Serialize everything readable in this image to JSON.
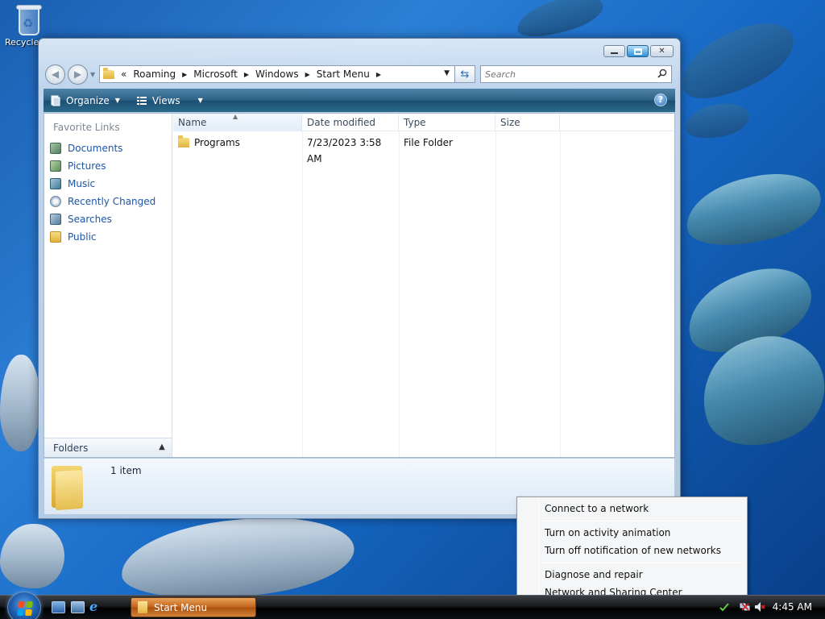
{
  "desktop": {
    "recycle_bin_label": "Recycle Bin"
  },
  "window": {
    "caption_buttons": [
      "minimize-icon",
      "maximize-icon",
      "close-icon"
    ],
    "address": {
      "overflow": "«",
      "crumbs": [
        "Roaming",
        "Microsoft",
        "Windows",
        "Start Menu"
      ]
    },
    "search_placeholder": "Search",
    "toolbar": {
      "organize_label": "Organize",
      "views_label": "Views",
      "help_label": "?"
    },
    "nav_pane": {
      "title": "Favorite Links",
      "links": [
        {
          "label": "Documents",
          "icon": "documents-icon"
        },
        {
          "label": "Pictures",
          "icon": "pictures-icon"
        },
        {
          "label": "Music",
          "icon": "music-icon"
        },
        {
          "label": "Recently Changed",
          "icon": "recently-changed-icon"
        },
        {
          "label": "Searches",
          "icon": "searches-icon"
        },
        {
          "label": "Public",
          "icon": "public-folder-icon"
        }
      ],
      "folders_label": "Folders"
    },
    "columns": [
      "Name",
      "Date modified",
      "Type",
      "Size"
    ],
    "rows": [
      {
        "name": "Programs",
        "date": "7/23/2023 3:58 AM",
        "type": "File Folder",
        "size": ""
      }
    ],
    "details": {
      "item_count": "1 item"
    }
  },
  "context_menu": {
    "items": [
      "Connect to a network",
      "Turn on activity animation",
      "Turn off notification of new networks",
      "Diagnose and repair",
      "Network and Sharing Center"
    ]
  },
  "taskbar": {
    "task_label": "Start Menu",
    "clock": "4:45 AM"
  },
  "colors": {
    "link": "#1d55a8",
    "toolbar": "#2d6287",
    "task_active": "#c4651c"
  }
}
